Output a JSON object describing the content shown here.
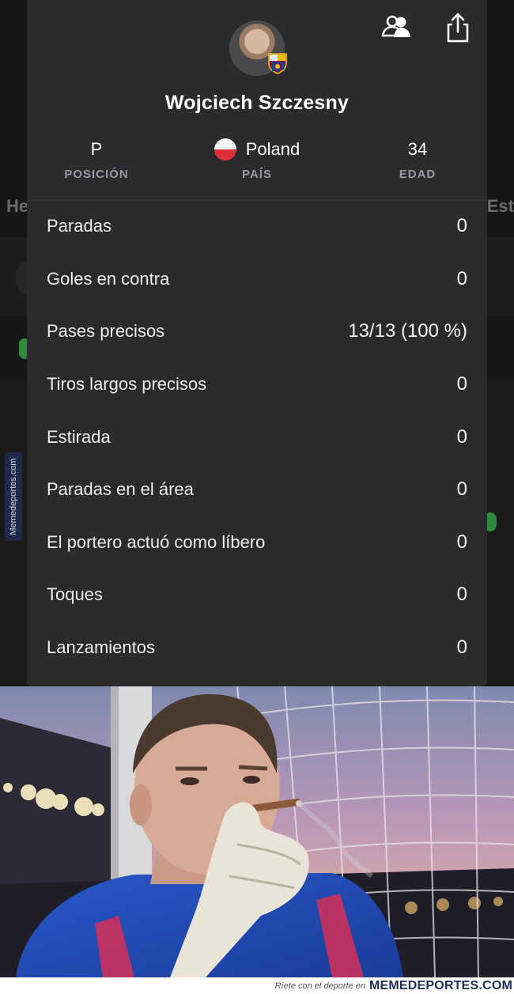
{
  "background": {
    "left_text": "He",
    "right_text": "Est",
    "side_watermark": "Memedeportes.com"
  },
  "header": {
    "friends_icon": "people-icon",
    "share_icon": "share-icon"
  },
  "player": {
    "name": "Wojciech Szczesny",
    "position_value": "P",
    "position_label": "POSICIÓN",
    "country_value": "Poland",
    "country_label": "PAÍS",
    "age_value": "34",
    "age_label": "EDAD"
  },
  "stats": [
    {
      "label": "Paradas",
      "value": "0"
    },
    {
      "label": "Goles en contra",
      "value": "0"
    },
    {
      "label": "Pases precisos",
      "value": "13/13 (100 %)"
    },
    {
      "label": "Tiros largos precisos",
      "value": "0"
    },
    {
      "label": "Estirada",
      "value": "0"
    },
    {
      "label": "Paradas en el área",
      "value": "0"
    },
    {
      "label": "El portero actuó como líbero",
      "value": "0"
    },
    {
      "label": "Toques",
      "value": "0"
    },
    {
      "label": "Lanzamientos",
      "value": "0"
    }
  ],
  "footer": {
    "tagline": "Ríete con el deporte en",
    "brand": "MEMEDEPORTES.COM"
  },
  "colors": {
    "sheet": "#2b2b2d",
    "flag_white": "#f4f4f4",
    "flag_red": "#dc2f3a",
    "brand": "#1f2a58"
  }
}
